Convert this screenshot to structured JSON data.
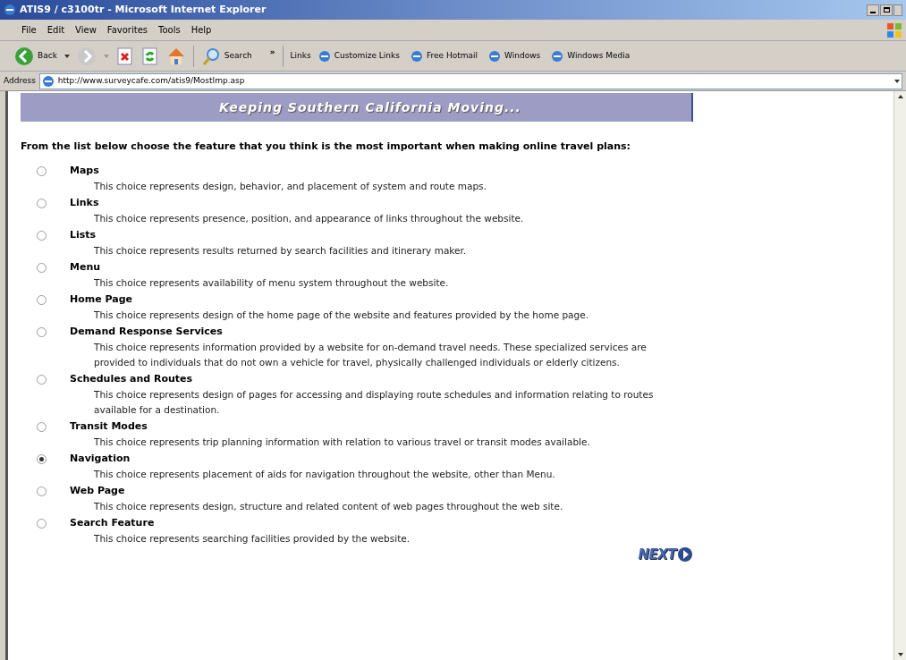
{
  "window": {
    "title": "ATIS9 / c3100tr - Microsoft Internet Explorer"
  },
  "menu": [
    "File",
    "Edit",
    "View",
    "Favorites",
    "Tools",
    "Help"
  ],
  "toolbar": {
    "back": "Back",
    "search": "Search",
    "chevron": "»",
    "links_label": "Links",
    "links": [
      "Customize Links",
      "Free Hotmail",
      "Windows",
      "Windows Media"
    ]
  },
  "address": {
    "label": "Address",
    "value": "http://www.surveycafe.com/atis9/MostImp.asp"
  },
  "page": {
    "banner": "Keeping Southern California Moving...",
    "question": "From the list below choose the feature that you think is the most important when making online travel plans:",
    "options": [
      {
        "label": "Maps",
        "description": "This choice represents design, behavior, and placement of system and route maps.",
        "selected": false
      },
      {
        "label": "Links",
        "description": "This choice represents presence, position, and appearance of links throughout the website.",
        "selected": false
      },
      {
        "label": "Lists",
        "description": "This choice represents results returned by search facilities and itinerary maker.",
        "selected": false
      },
      {
        "label": "Menu",
        "description": "This choice represents availability of menu system throughout the website.",
        "selected": false
      },
      {
        "label": "Home Page",
        "description": "This choice represents design of the home page of the website and features provided by the home page.",
        "selected": false
      },
      {
        "label": "Demand Response Services",
        "description": "This choice represents information provided by a website for on-demand travel needs. These specialized services are provided to individuals that do not own a vehicle for travel, physically challenged individuals or elderly citizens.",
        "selected": false
      },
      {
        "label": "Schedules and Routes",
        "description": "This choice represents design of pages for accessing and displaying route schedules and information relating to routes available for a destination.",
        "selected": false
      },
      {
        "label": "Transit Modes",
        "description": "This choice represents trip planning information with relation to various travel or transit modes available.",
        "selected": false
      },
      {
        "label": "Navigation",
        "description": "This choice represents placement of aids for navigation throughout the website, other than Menu.",
        "selected": true
      },
      {
        "label": "Web Page",
        "description": "This choice represents design, structure and related content of web pages throughout the web site.",
        "selected": false
      },
      {
        "label": "Search Feature",
        "description": "This choice represents searching facilities provided by the website.",
        "selected": false
      }
    ],
    "next": "NEXT"
  }
}
